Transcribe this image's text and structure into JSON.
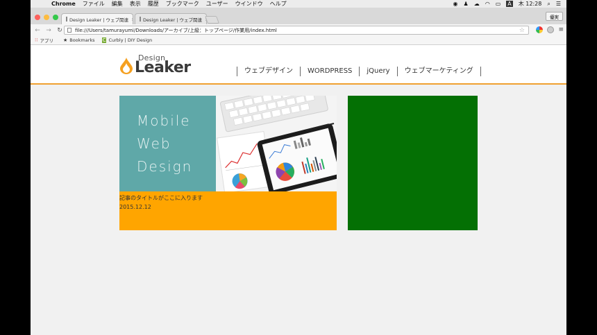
{
  "menubar": {
    "app_name": "Chrome",
    "items": [
      "ファイル",
      "編集",
      "表示",
      "履歴",
      "ブックマーク",
      "ユーザー",
      "ウインドウ",
      "ヘルプ"
    ],
    "clock": "木 12:28"
  },
  "tabs": [
    {
      "title": "Design Leaker | ウェブ関連",
      "active": true
    },
    {
      "title": "Design Leaker | ウェブ関連",
      "active": false
    }
  ],
  "profile_button": "優実",
  "address_bar": {
    "url": "file:///Users/tamurayumi/Downloads/アーカイブ/上級：トップページ/作業用/index.html"
  },
  "bookmarks": [
    {
      "label": "アプリ",
      "icon": "apps-grid-icon"
    },
    {
      "label": "Bookmarks",
      "icon": "star-icon"
    },
    {
      "label": "Curbly | DIY Design",
      "icon": "curbly-icon"
    }
  ],
  "site": {
    "logo_top": "Design",
    "logo_bottom": "Leaker",
    "nav": [
      "ウェブデザイン",
      "WORDPRESS",
      "jQuery",
      "ウェブマーケティング"
    ],
    "hero_lines": [
      "Mobile",
      "Web",
      "Design"
    ],
    "card_title": "記事のタイトルがここに入ります",
    "card_date": "2015.12.12"
  },
  "colors": {
    "accent_orange": "#ffa500",
    "card_green": "#047004",
    "hero_teal": "#5fa8a8"
  }
}
